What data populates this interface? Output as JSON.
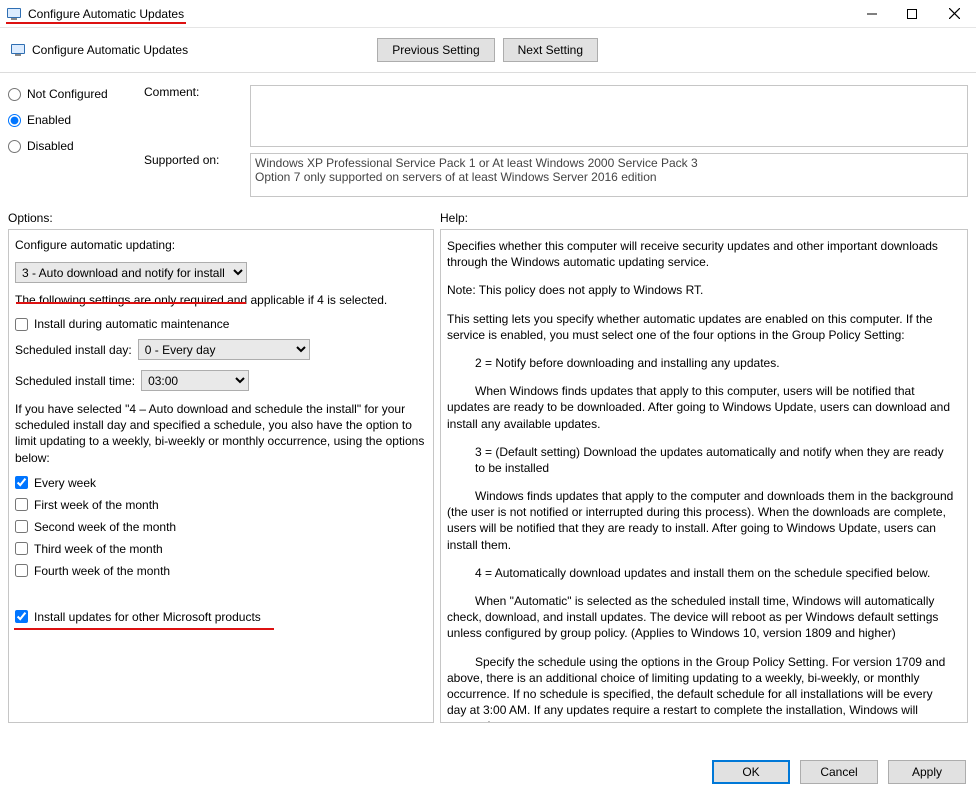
{
  "window": {
    "title": "Configure Automatic Updates",
    "subtitle": "Configure Automatic Updates"
  },
  "nav": {
    "prev": "Previous Setting",
    "next": "Next Setting"
  },
  "state": {
    "not_configured": "Not Configured",
    "enabled": "Enabled",
    "disabled": "Disabled",
    "selected": "enabled"
  },
  "comment_label": "Comment:",
  "comment_value": "",
  "supported_label": "Supported on:",
  "supported_value": "Windows XP Professional Service Pack 1 or At least Windows 2000 Service Pack 3\nOption 7 only supported on servers of at least Windows Server 2016 edition",
  "sections": {
    "options": "Options:",
    "help": "Help:"
  },
  "options": {
    "configure_label": "Configure automatic updating:",
    "configure_value": "3 - Auto download and notify for install",
    "note_if4": "The following settings are only required and applicable if 4 is selected.",
    "install_maintenance": {
      "label": "Install during automatic maintenance",
      "checked": false
    },
    "day_label": "Scheduled install day: ",
    "day_value": "0 - Every day",
    "time_label": "Scheduled install time:",
    "time_value": "03:00",
    "schedule_note": "If you have selected \"4 – Auto download and schedule the install\" for your scheduled install day and specified a schedule, you also have the option to limit updating to a weekly, bi-weekly or monthly occurrence, using the options below:",
    "weeks": [
      {
        "label": "Every week",
        "checked": true
      },
      {
        "label": "First week of the month",
        "checked": false
      },
      {
        "label": "Second week of the month",
        "checked": false
      },
      {
        "label": "Third week of the month",
        "checked": false
      },
      {
        "label": "Fourth week of the month",
        "checked": false
      }
    ],
    "other_products": {
      "label": "Install updates for other Microsoft products",
      "checked": true
    }
  },
  "help_text": {
    "p1": "Specifies whether this computer will receive security updates and other important downloads through the Windows automatic updating service.",
    "p2": "Note: This policy does not apply to Windows RT.",
    "p3": "This setting lets you specify whether automatic updates are enabled on this computer. If the service is enabled, you must select one of the four options in the Group Policy Setting:",
    "n2": "2 = Notify before downloading and installing any updates.",
    "n2b": "When Windows finds updates that apply to this computer, users will be notified that updates are ready to be downloaded. After going to Windows Update, users can download and install any available updates.",
    "n3": "3 = (Default setting) Download the updates automatically and notify when they are ready to be installed",
    "n3b": "Windows finds updates that apply to the computer and downloads them in the background (the user is not notified or interrupted during this process). When the downloads are complete, users will be notified that they are ready to install. After going to Windows Update, users can install them.",
    "n4": "4 = Automatically download updates and install them on the schedule specified below.",
    "n4b": "When \"Automatic\" is selected as the scheduled install time, Windows will automatically check, download, and install updates. The device will reboot as per Windows default settings unless configured by group policy. (Applies to Windows 10, version 1809 and higher)",
    "n4c": "Specify the schedule using the options in the Group Policy Setting. For version 1709 and above, there is an additional choice of limiting updating to a weekly, bi-weekly, or monthly occurrence. If no schedule is specified, the default schedule for all installations will be every day at 3:00 AM. If any updates require a restart to complete the installation, Windows will restart the"
  },
  "buttons": {
    "ok": "OK",
    "cancel": "Cancel",
    "apply": "Apply"
  }
}
